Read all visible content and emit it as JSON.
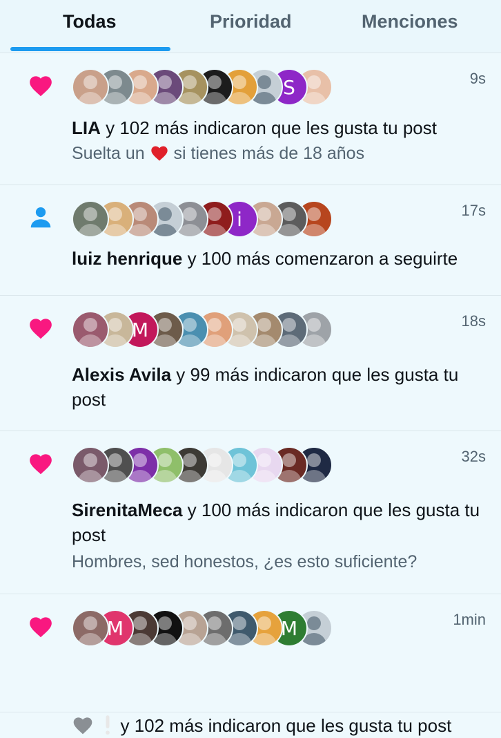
{
  "tabs": [
    {
      "label": "Todas",
      "active": true
    },
    {
      "label": "Prioridad",
      "active": false
    },
    {
      "label": "Menciones",
      "active": false
    }
  ],
  "colors": {
    "accent": "#1d9bf0",
    "like": "#f91880",
    "follow": "#1d9bf0",
    "background": "#eef9fd",
    "secondary_text": "#536471"
  },
  "notifications": [
    {
      "type": "like",
      "icon": "heart-icon",
      "time": "9s",
      "actor": "LIA",
      "action": " y 102 más indicaron que les gusta tu post",
      "preview_before": "Suelta un ",
      "preview_emoji": "red-heart-emoji",
      "preview_after": " si tienes más de 18 años",
      "avatars": [
        {
          "color": "#c9a08a"
        },
        {
          "color": "#7d8a8e"
        },
        {
          "color": "#d9a98c"
        },
        {
          "color": "#6b4a7a"
        },
        {
          "color": "#a6925f"
        },
        {
          "color": "#1c1c1c"
        },
        {
          "color": "#e3a03a"
        },
        {
          "color": "default"
        },
        {
          "color": "#8e27c7",
          "initial": "S"
        },
        {
          "color": "#e8c0a8"
        }
      ]
    },
    {
      "type": "follow",
      "icon": "person-icon",
      "time": "17s",
      "actor": "luiz henrique",
      "action": " y 100 más comenzaron a seguirte",
      "avatars": [
        {
          "color": "#6f7b6d"
        },
        {
          "color": "#d9b07a"
        },
        {
          "color": "#b98a78"
        },
        {
          "color": "default"
        },
        {
          "color": "#8d8f95"
        },
        {
          "color": "#8f1d1d"
        },
        {
          "color": "#8e27c7",
          "initial": "i"
        },
        {
          "color": "#c9a893"
        },
        {
          "color": "#5c5c5c"
        },
        {
          "color": "#b7461e"
        }
      ]
    },
    {
      "type": "like",
      "icon": "heart-icon",
      "time": "18s",
      "actor": "Alexis Avila",
      "action": " y 99 más indicaron que les gusta tu post",
      "avatars": [
        {
          "color": "#9a5a6e"
        },
        {
          "color": "#c8b79a"
        },
        {
          "color": "#c2185b",
          "initial": "M"
        },
        {
          "color": "#6d5b4a"
        },
        {
          "color": "#4a8fb0"
        },
        {
          "color": "#e0a07a"
        },
        {
          "color": "#cfc2ad"
        },
        {
          "color": "#a48a6e"
        },
        {
          "color": "#5d6b78"
        },
        {
          "color": "#9ea3a8"
        }
      ]
    },
    {
      "type": "like",
      "icon": "heart-icon",
      "time": "32s",
      "actor": "SirenitaMeca",
      "action": " y 100 más indicaron que les gusta tu post",
      "preview_before": "Hombres, sed honestos, ¿es esto suficiente?",
      "avatars": [
        {
          "color": "#7a5a6a"
        },
        {
          "color": "#4f4f4f"
        },
        {
          "color": "#7d2fa8"
        },
        {
          "color": "#8fbf6a"
        },
        {
          "color": "#3d3a35"
        },
        {
          "color": "#e6e6e6"
        },
        {
          "color": "#6ec3d8"
        },
        {
          "color": "#e8d8f0"
        },
        {
          "color": "#6a2a24"
        },
        {
          "color": "#1f2a44"
        }
      ]
    },
    {
      "type": "like",
      "icon": "heart-icon",
      "time": "1min",
      "actor": "",
      "actor_emoji": true,
      "action": " y 102 más indicaron que les gusta tu post",
      "avatars": [
        {
          "color": "#8c6a66"
        },
        {
          "color": "#e0356d",
          "initial": "M"
        },
        {
          "color": "#4b3a35"
        },
        {
          "color": "#111111"
        },
        {
          "color": "#b8a394"
        },
        {
          "color": "#6d6d6d"
        },
        {
          "color": "#3f5a6d"
        },
        {
          "color": "#e6a23c"
        },
        {
          "color": "#2e7d32",
          "initial": "M"
        },
        {
          "color": "default"
        }
      ]
    }
  ]
}
